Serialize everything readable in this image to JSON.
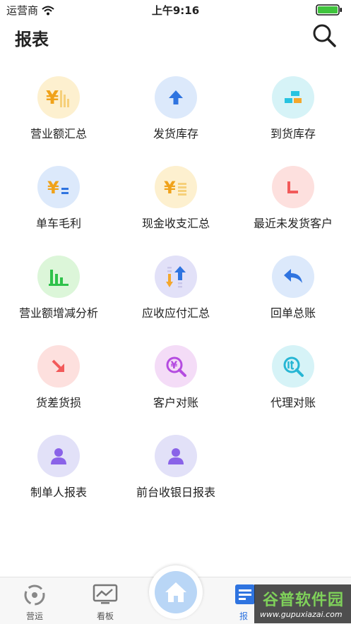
{
  "status": {
    "carrier": "运营商",
    "time": "上午9:16"
  },
  "header": {
    "title": "报表"
  },
  "reports": [
    {
      "label": "营业额汇总",
      "icon": "revenue-summary-icon",
      "bg": "#fdf0cf"
    },
    {
      "label": "发货库存",
      "icon": "upload-arrow-icon",
      "bg": "#dce9fb"
    },
    {
      "label": "到货库存",
      "icon": "stock-blocks-icon",
      "bg": "#d6f3f7"
    },
    {
      "label": "单车毛利",
      "icon": "yen-minus-icon",
      "bg": "#dce9fb"
    },
    {
      "label": "现金收支汇总",
      "icon": "cash-coins-icon",
      "bg": "#fdf0cf"
    },
    {
      "label": "最近未发货客户",
      "icon": "l-shape-icon",
      "bg": "#fde0de"
    },
    {
      "label": "营业额增减分析",
      "icon": "bar-chart-icon",
      "bg": "#dcf6d9"
    },
    {
      "label": "应收应付汇总",
      "icon": "updown-arrows-icon",
      "bg": "#e2e1f8"
    },
    {
      "label": "回单总账",
      "icon": "reply-arrow-icon",
      "bg": "#dce9fb"
    },
    {
      "label": "货差货损",
      "icon": "down-right-arrow-icon",
      "bg": "#fde0de"
    },
    {
      "label": "客户对账",
      "icon": "yen-search-icon",
      "bg": "#f4dcf7"
    },
    {
      "label": "代理对账",
      "icon": "it-search-icon",
      "bg": "#d6f3f7"
    },
    {
      "label": "制单人报表",
      "icon": "person-icon",
      "bg": "#e2e1f8"
    },
    {
      "label": "前台收银日报表",
      "icon": "person-icon",
      "bg": "#e2e1f8"
    }
  ],
  "tabs": [
    {
      "label": "营运",
      "icon": "operations-icon"
    },
    {
      "label": "看板",
      "icon": "dashboard-icon"
    },
    {
      "label": "报",
      "icon": "report-icon"
    }
  ],
  "watermark": {
    "title": "谷普软件园",
    "url": "www.gupuxiazai.com"
  },
  "colors": {
    "active_tab": "#2f74e0",
    "home": "#b9d6f6"
  }
}
